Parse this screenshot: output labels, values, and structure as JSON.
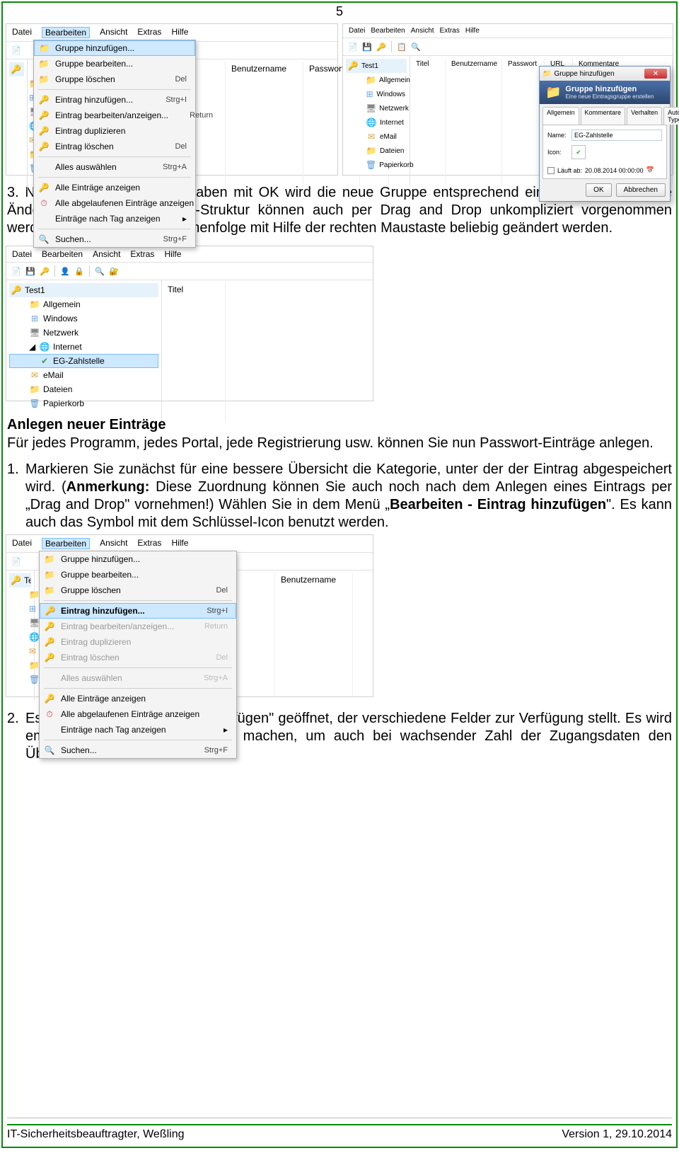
{
  "page_number": "5",
  "menus": {
    "datei": "Datei",
    "bearbeiten": "Bearbeiten",
    "ansicht": "Ansicht",
    "extras": "Extras",
    "hilfe": "Hilfe"
  },
  "table_cols": {
    "titel": "Titel",
    "benutzer": "Benutzername",
    "passwort": "Passwort",
    "url": "URL",
    "kommentare": "Kommentare"
  },
  "tree": {
    "root": "Test1",
    "allgemein": "Allgemein",
    "windows": "Windows",
    "netzwerk": "Netzwerk",
    "internet": "Internet",
    "email": "eMail",
    "dateien": "Dateien",
    "papierkorb": "Papierkorb",
    "eg": "EG-Zahlstelle"
  },
  "edit_menu": {
    "gr_add": "Gruppe hinzufügen...",
    "gr_edit": "Gruppe bearbeiten...",
    "gr_del": "Gruppe löschen",
    "gr_del_s": "Del",
    "ent_add": "Eintrag hinzufügen...",
    "ent_add_s": "Strg+I",
    "ent_edit": "Eintrag bearbeiten/anzeigen...",
    "ent_edit_s": "Return",
    "ent_dup": "Eintrag duplizieren",
    "ent_del": "Eintrag löschen",
    "ent_del_s": "Del",
    "sel_all": "Alles auswählen",
    "sel_all_s": "Strg+A",
    "show_all": "Alle Einträge anzeigen",
    "show_exp": "Alle abgelaufenen Einträge anzeigen",
    "show_tag": "Einträge nach Tag anzeigen",
    "search": "Suchen...",
    "search_s": "Strg+F"
  },
  "dialog": {
    "title": "Gruppe hinzufügen",
    "banner_title": "Gruppe hinzufügen",
    "banner_sub": "Eine neue Eintragsgruppe erstellen",
    "tab_allg": "Allgemein",
    "tab_komm": "Kommentare",
    "tab_verh": "Verhalten",
    "tab_auto": "Auto-Type",
    "name_label": "Name:",
    "name_value": "EG-Zahlstelle",
    "icon_label": "Icon:",
    "expire_label": "Läuft ab:",
    "expire_value": "20.08.2014 00:00:00",
    "ok": "OK",
    "cancel": "Abbrechen"
  },
  "text": {
    "para1a": "3. Nach Bestätigung der Angaben mit OK wird die neue Gruppe entsprechend eingefügt. Gewünschte Änderungen in der Gruppen-Struktur können auch per Drag and Drop unkompliziert vorgenommen werden. Ebenso kann die Reihenfolge mit Hilfe der rechten Maustaste beliebig geändert werden.",
    "heading1": "Anlegen neuer Einträge",
    "para2": "Für jedes Programm, jedes Portal, jede Registrierung usw. können Sie nun Passwort-Einträge anlegen.",
    "step1_num": "1.",
    "step1_a": "Markieren Sie zunächst für eine bessere Übersicht die Kategorie, unter der der Eintrag abgespeichert wird. (",
    "step1_bold1": "Anmerkung:",
    "step1_b": " Diese Zuordnung können Sie auch noch nach dem Anlegen eines Eintrags per „Drag and Drop\" vornehmen!) Wählen Sie in dem Menü „",
    "step1_bold2": "Bearbeiten - Eintrag hinzufügen",
    "step1_c": "\". Es kann auch das Symbol mit dem Schlüssel-Icon benutzt werden.",
    "step2_num": "2.",
    "step2": "Es wird der Dialog „Eintrag hinzufügen\" geöffnet, der verschiedene Felder zur Verfügung stellt. Es wird empfohlen genaue Angaben zu machen, um auch bei wachsender Zahl der Zugangsdaten den Überblick zu behalten."
  },
  "footer": {
    "left": "IT-Sicherheitsbeauftragter, Weßling",
    "right": "Version 1, 29.10.2014"
  }
}
